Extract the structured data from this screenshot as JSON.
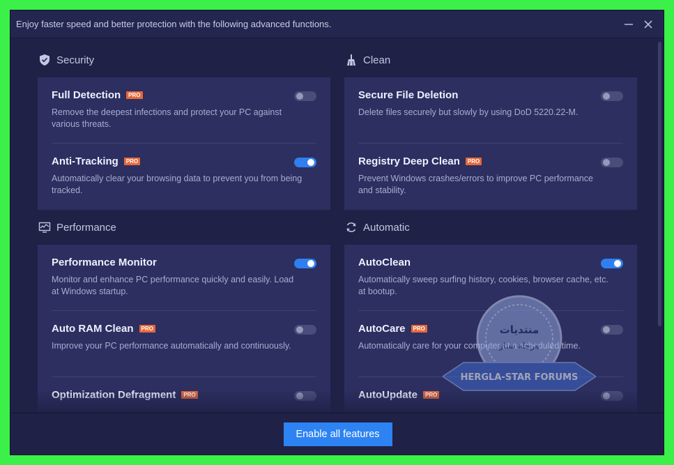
{
  "window": {
    "title": "Enjoy faster speed and better protection with the following advanced functions."
  },
  "sections": {
    "security": {
      "title": "Security",
      "items": [
        {
          "title": "Full Detection",
          "pro": "PRO",
          "desc": "Remove the deepest infections and protect your PC against various threats.",
          "enabled": false
        },
        {
          "title": "Anti-Tracking",
          "pro": "PRO",
          "desc": "Automatically clear your browsing data to prevent you from being tracked.",
          "enabled": true
        }
      ]
    },
    "clean": {
      "title": "Clean",
      "items": [
        {
          "title": "Secure File Deletion",
          "desc": "Delete files securely but slowly by using DoD 5220.22-M.",
          "enabled": false
        },
        {
          "title": "Registry Deep Clean",
          "pro": "PRO",
          "desc": "Prevent Windows crashes/errors to improve PC performance and stability.",
          "enabled": false
        }
      ]
    },
    "performance": {
      "title": "Performance",
      "items": [
        {
          "title": "Performance Monitor",
          "desc": "Monitor and enhance PC performance quickly and easily. Load at Windows startup.",
          "enabled": true
        },
        {
          "title": "Auto RAM Clean",
          "pro": "PRO",
          "desc": "Improve your PC performance automatically and continuously.",
          "enabled": false
        },
        {
          "title": "Optimization Defragment",
          "pro": "PRO",
          "desc": "",
          "enabled": false
        }
      ]
    },
    "automatic": {
      "title": "Automatic",
      "items": [
        {
          "title": "AutoClean",
          "desc": "Automatically sweep surfing history, cookies, browser cache, etc. at bootup.",
          "enabled": true
        },
        {
          "title": "AutoCare",
          "pro": "PRO",
          "desc": "Automatically care for your computer at a scheduled time.",
          "enabled": false
        },
        {
          "title": "AutoUpdate",
          "pro": "PRO",
          "desc": "",
          "enabled": false
        }
      ]
    }
  },
  "footer": {
    "enable_all_label": "Enable all features"
  },
  "watermark": {
    "arabic_top": "منتديات",
    "arabic_bottom": "هرجلة ستار",
    "banner": "HERGLA-STAR FORUMS"
  },
  "icons": {
    "security": "shield-icon",
    "clean": "broom-icon",
    "performance": "monitor-chart-icon",
    "automatic": "refresh-icon",
    "minimize": "minimize-icon",
    "close": "close-icon"
  },
  "colors": {
    "background": "#1f2147",
    "card": "#2c2f5f",
    "toggle_on": "#2f7ff0",
    "pro_badge": "#e7683a",
    "primary_button": "#2d83f2"
  }
}
